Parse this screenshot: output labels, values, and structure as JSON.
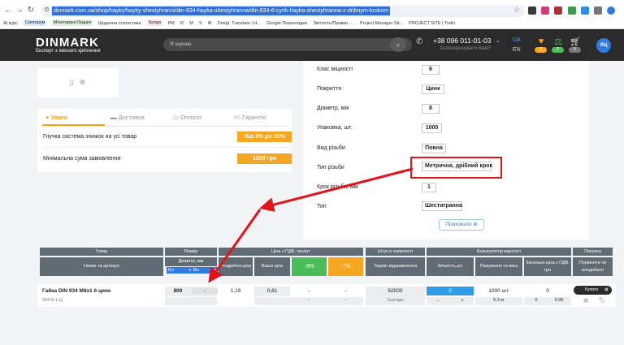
{
  "browser": {
    "url": "dinmark.com.ua/shop/hayky/hayky-shestyhranni/din-934-hayka-shestyhranna/din-934-6-cynk-hayka-shestyhranna-z-dribnym-krokom",
    "bookmarks": [
      "AI курс",
      "Сингерум",
      "Моніторинг/Задачі",
      "Щоденна статистика",
      "Songs",
      "PM",
      "R",
      "M",
      "S",
      "M",
      "Deepl. Translate | Н...",
      "Google Перекладач",
      "Звітність/Правки -...",
      "Project Manager Sit...",
      "PROJECT SITE | Trello"
    ]
  },
  "header": {
    "logo": "DINMARK",
    "tagline": "Експерт з якісного кріплення",
    "search_placeholder": "Я шукаю",
    "phone": "+38 096 011-01-03",
    "callback": "Зателефонувати Вам?",
    "lang_active": "UA",
    "lang_other": "EN",
    "badges": [
      "2",
      "2",
      "0"
    ],
    "avatar": "ЯЦ"
  },
  "info": {
    "tabs": [
      "Увага",
      "Доставка",
      "Оплати",
      "Гарантія"
    ],
    "rows": [
      {
        "label": "Гнучка система знижок на усі товар",
        "badge": "Від 3% до 30%"
      },
      {
        "label": "Мінімальна сума замовлення",
        "badge": "1200 грн"
      }
    ]
  },
  "specs": {
    "rows": [
      {
        "label": "Клас міцності",
        "value": "6"
      },
      {
        "label": "Покриття",
        "value": "Цинк"
      },
      {
        "label": "Діаметр, мм",
        "value": "8"
      },
      {
        "label": "Упаковка, шт.",
        "value": "1000"
      },
      {
        "label": "Вид різьби",
        "value": "Повна"
      },
      {
        "label": "Тип різьби",
        "value": "Метрична, дрібний крок"
      },
      {
        "label": "Крок різьби, мм",
        "value": "1"
      },
      {
        "label": "Тип",
        "value": "Шестигранна"
      }
    ],
    "hide_button": "Приховати"
  },
  "table": {
    "groups": [
      "Товар",
      "Розмір",
      "Ціна з ПДВ, грн/шт",
      "Штук в наявності",
      "Калькулятор вартості",
      "Покупка"
    ],
    "subheaders": {
      "product": "Назва та артикул",
      "size": "Діаметр, мм",
      "size_select_1": "Всі",
      "size_select_2": "Всі",
      "price_retail": "Роздрібна ціна",
      "price_your": "Ваша ціна",
      "price_3": "-3%",
      "price_7": "-7%",
      "stock": "Термін відправлення",
      "calc_qty": "Кількість,шт",
      "calc_pack": "Пакування та вага",
      "calc_total": "Загальна ціна з ПДВ, грн",
      "buy": "Порівняти чи вподобати"
    },
    "row": {
      "name": "Гайка DIN 934 М8х1 6 цинк",
      "sku": "934-8-1-Ц",
      "diameter": "800",
      "step": "-",
      "retail": "1,19",
      "your": "0,81",
      "p3": "-",
      "p7": "-",
      "p3b": "-",
      "p7b": "-",
      "stock": "62000",
      "stock_note": "Сьогодні",
      "qty": "0",
      "minus": "-",
      "plus": "+",
      "pack": "1000 шт.",
      "weight": "5.3 кг",
      "total": "0",
      "total2": "0",
      "total3": "0.00",
      "buy": "Купити"
    }
  },
  "colors": {
    "accent_orange": "#f5a623",
    "accent_blue": "#2f7be0",
    "annotation_red": "#e0141b",
    "header_dark": "#2b2b2b"
  }
}
